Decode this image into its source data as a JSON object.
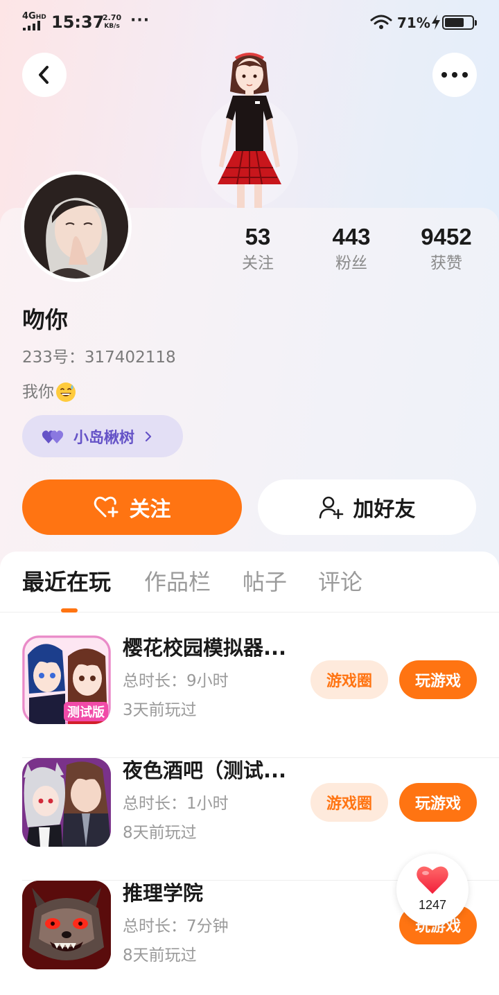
{
  "status_bar": {
    "network": "4G",
    "network_badge": "HD",
    "time": "15:37",
    "speed_value": "2.70",
    "speed_unit": "KB/s",
    "more": "···",
    "battery": "71%",
    "battery_level": 0.71
  },
  "header": {
    "back_icon": "chevron-left-icon",
    "more_icon": "more-dots-icon"
  },
  "profile": {
    "nickname": "吻你",
    "uid": "233号：317402118",
    "bio": "我你",
    "bio_emoji": "sweat-smile-emoji",
    "island_tag": "小岛楸树",
    "stats": [
      {
        "value": "53",
        "label": "关注"
      },
      {
        "value": "443",
        "label": "粉丝"
      },
      {
        "value": "9452",
        "label": "获赞"
      }
    ]
  },
  "actions": {
    "follow": "关注",
    "add_friend": "加好友"
  },
  "tabs": [
    "最近在玩",
    "作品栏",
    "帖子",
    "评论"
  ],
  "active_tab": 0,
  "games": [
    {
      "title": "樱花校园模拟器...",
      "duration": "总时长：9小时",
      "last_played": "3天前玩过",
      "circle": "游戏圈",
      "play": "玩游戏"
    },
    {
      "title": "夜色酒吧（测试...",
      "duration": "总时长：1小时",
      "last_played": "8天前玩过",
      "circle": "游戏圈",
      "play": "玩游戏"
    },
    {
      "title": "推理学院",
      "duration": "总时长：7分钟",
      "last_played": "8天前玩过",
      "circle": "",
      "play": "玩游戏"
    }
  ],
  "game_badge": "测试版",
  "like_float": {
    "count": "1247",
    "icon": "heart-icon"
  },
  "colors": {
    "accent": "#ff7412",
    "accent_soft": "#feeadc",
    "tag_bg": "#e3dff5",
    "tag_text": "#6553c7"
  }
}
